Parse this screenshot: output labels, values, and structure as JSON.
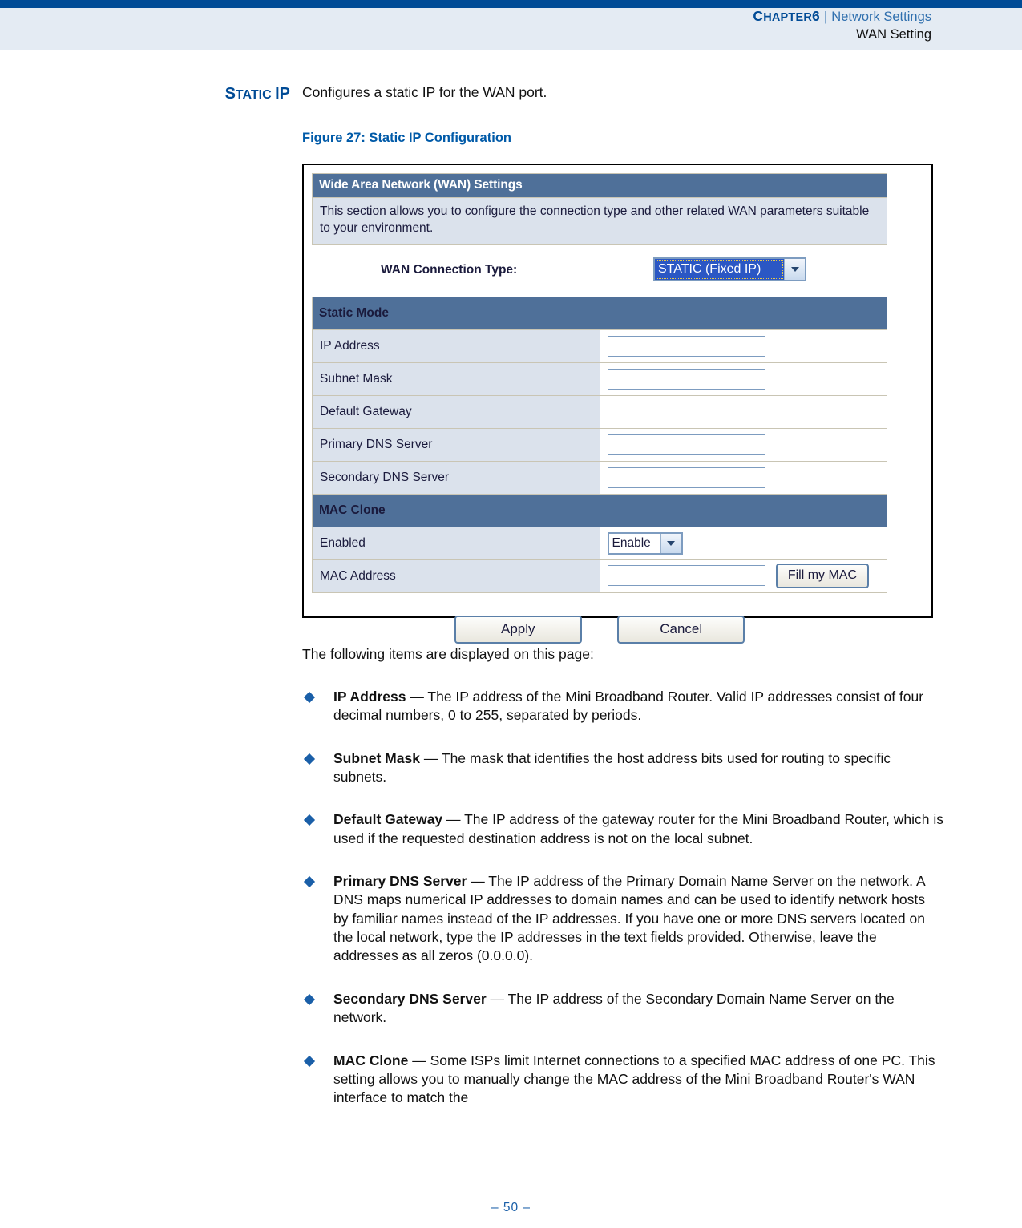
{
  "header": {
    "chapter_label_cap": "C",
    "chapter_label_rest": "HAPTER",
    "chapter_number": "6",
    "separator": "|",
    "section": "Network Settings",
    "subsection": "WAN Setting"
  },
  "marginal": {
    "cap1": "S",
    "rest1": "TATIC",
    "cap2": "IP"
  },
  "intro": {
    "text": "Configures a static IP for the WAN port."
  },
  "figure": {
    "caption": "Figure 27:  Static IP Configuration",
    "panel_title": "Wide Area Network (WAN) Settings",
    "panel_description": "This section allows you to configure the connection type and other related WAN parameters suitable to your environment.",
    "connection_type_label": "WAN Connection Type:",
    "connection_type_value": "STATIC (Fixed IP)",
    "static_section_title": "Static Mode",
    "static_rows": [
      {
        "label": "IP Address",
        "value": ""
      },
      {
        "label": "Subnet Mask",
        "value": ""
      },
      {
        "label": "Default Gateway",
        "value": ""
      },
      {
        "label": "Primary DNS Server",
        "value": ""
      },
      {
        "label": "Secondary DNS Server",
        "value": ""
      }
    ],
    "mac_section_title": "MAC Clone",
    "mac_enabled_label": "Enabled",
    "mac_enabled_value": "Enable",
    "mac_address_label": "MAC Address",
    "mac_address_value": "",
    "fill_my_mac_label": "Fill my MAC",
    "apply_label": "Apply",
    "cancel_label": "Cancel",
    "colors": {
      "section_bar": "#4f7099",
      "label_cell": "#dbe2ec",
      "select_highlight": "#2b57c4"
    }
  },
  "body": {
    "lead_in": "The following items are displayed on this page:",
    "bullets": [
      {
        "term": "IP Address",
        "dash": " — ",
        "desc": "The IP address of the Mini Broadband Router. Valid IP addresses consist of four decimal numbers, 0 to 255, separated by periods."
      },
      {
        "term": "Subnet Mask",
        "dash": " — ",
        "desc": "The mask that identifies the host address bits used for routing to specific subnets."
      },
      {
        "term": "Default Gateway",
        "dash": " — ",
        "desc": "The IP address of the gateway router for the Mini Broadband Router, which is used if the requested destination address is not on the local subnet."
      },
      {
        "term": "Primary DNS Server",
        "dash": " — ",
        "desc": "The IP address of the Primary Domain Name Server on the network. A DNS maps numerical IP addresses to domain names and can be used to identify network hosts by familiar names instead of the IP addresses. If you have one or more DNS servers located on the local network, type the IP addresses in the text fields provided. Otherwise, leave the addresses as all zeros (0.0.0.0)."
      },
      {
        "term": "Secondary DNS Server",
        "dash": " — ",
        "desc": "The IP address of the Secondary Domain Name Server on the network."
      },
      {
        "term": "MAC Clone",
        "dash": " — ",
        "desc": "Some ISPs limit Internet connections to a specified MAC address of one PC. This setting allows you to manually change the MAC address of the Mini Broadband Router's WAN interface to match the"
      }
    ]
  },
  "footer": {
    "page": "–  50  –"
  },
  "theme": {
    "rule_blue": "#004b96",
    "header_band": "#e4ebf3",
    "link_blue": "#2f6fae",
    "heading_blue": "#005aa8",
    "bullet_blue": "#1a5fa8"
  }
}
